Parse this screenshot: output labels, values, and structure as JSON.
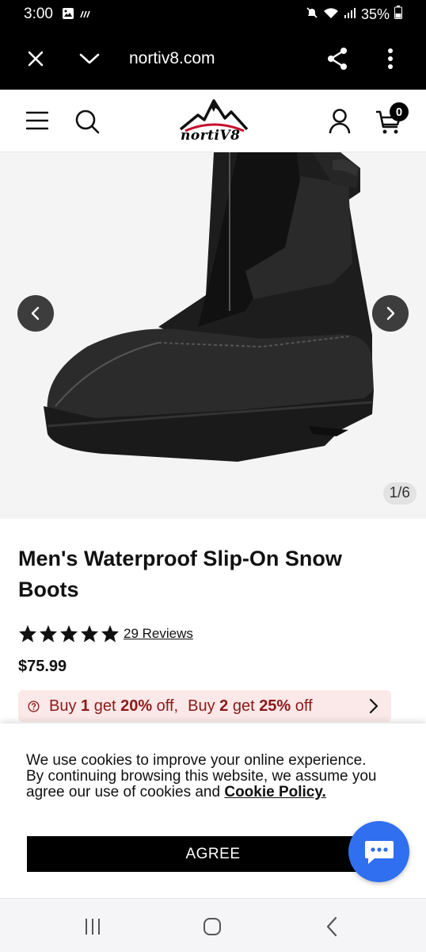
{
  "status_bar": {
    "time": "3:00",
    "battery": "35%",
    "icons": [
      "gallery-icon",
      "signal-icon",
      "mute-icon",
      "wifi-icon",
      "cell-signal-icon",
      "battery-icon"
    ]
  },
  "browser": {
    "url": "nortiv8.com",
    "icons": [
      "close-icon",
      "chevron-down-icon",
      "share-icon",
      "more-vert-icon"
    ]
  },
  "header": {
    "logo_text": "nortiV8",
    "cart_count": "0",
    "icons": [
      "menu-icon",
      "search-icon",
      "account-icon",
      "cart-icon"
    ]
  },
  "gallery": {
    "counter": "1/6"
  },
  "product": {
    "title": "Men's Waterproof Slip-On Snow Boots",
    "rating": 5,
    "reviews_label": "29 Reviews",
    "price": "$75.99"
  },
  "promo": {
    "part1_a": "Buy ",
    "part1_b": "1",
    "part1_c": " get ",
    "part1_d": "20%",
    "part1_e": " off,",
    "part2_a": "Buy ",
    "part2_b": "2",
    "part2_c": " get ",
    "part2_d": "25%",
    "part2_e": " off"
  },
  "cookie": {
    "text": "We use cookies to improve your online experience. By continuing browsing this website, we assume you agree our use of cookies and ",
    "link": "Cookie Policy.",
    "agree_label": "AGREE"
  },
  "colors": {
    "promo_bg": "#fbe8e8",
    "promo_text": "#8b1a1a",
    "chat_button": "#2f6ff0",
    "logo_red": "#c8102e"
  }
}
